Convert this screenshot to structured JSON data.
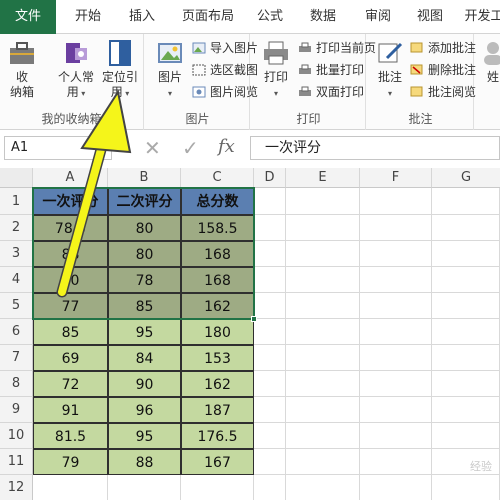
{
  "tabs": [
    "文件",
    "开始",
    "插入",
    "页面布局",
    "公式",
    "数据",
    "审阅",
    "视图",
    "开发工"
  ],
  "ribbon": {
    "group_my": {
      "label": "我的收纳箱",
      "btn_box": "收\n纳箱",
      "btn_personal": "个人常\n用",
      "btn_locate": "定位引\n用"
    },
    "group_picture": {
      "label": "图片",
      "btn_picture": "图片",
      "small": [
        "导入图片",
        "选区截图",
        "图片阅览"
      ]
    },
    "group_print": {
      "label": "打印",
      "btn_print": "打印",
      "small": [
        "打印当前页",
        "批量打印",
        "双面打印"
      ]
    },
    "group_comment": {
      "label": "批注",
      "btn_comment": "批注",
      "small": [
        "添加批注",
        "删除批注",
        "批注阅览"
      ]
    },
    "group_name": {
      "btn_name": "姓"
    }
  },
  "formula_bar": {
    "name_box": "A1",
    "cancel_icon": "close-icon",
    "confirm_icon": "check-icon",
    "fx_label": "fx",
    "formula": "一次评分"
  },
  "columns": [
    "A",
    "B",
    "C",
    "D",
    "E",
    "F",
    "G"
  ],
  "rows": [
    "1",
    "2",
    "3",
    "4",
    "5",
    "6",
    "7",
    "8",
    "9",
    "10",
    "11",
    "12"
  ],
  "table": {
    "headers": [
      "一次评分",
      "二次评分",
      "总分数"
    ],
    "rows": [
      [
        "78.5",
        "80",
        "158.5"
      ],
      [
        "88",
        "80",
        "168"
      ],
      [
        "90",
        "78",
        "168"
      ],
      [
        "77",
        "85",
        "162"
      ],
      [
        "85",
        "95",
        "180"
      ],
      [
        "69",
        "84",
        "153"
      ],
      [
        "72",
        "90",
        "162"
      ],
      [
        "91",
        "96",
        "187"
      ],
      [
        "81.5",
        "95",
        "176.5"
      ],
      [
        "79",
        "88",
        "167"
      ]
    ]
  },
  "selected_range": "A1:C5",
  "colors": {
    "accent": "#217346",
    "header_fill": "#5b7fb1",
    "data_fill": "#c4d9a0",
    "selected_fill": "#9eab84",
    "arrow": "#f5f51a"
  },
  "watermark": "经验"
}
